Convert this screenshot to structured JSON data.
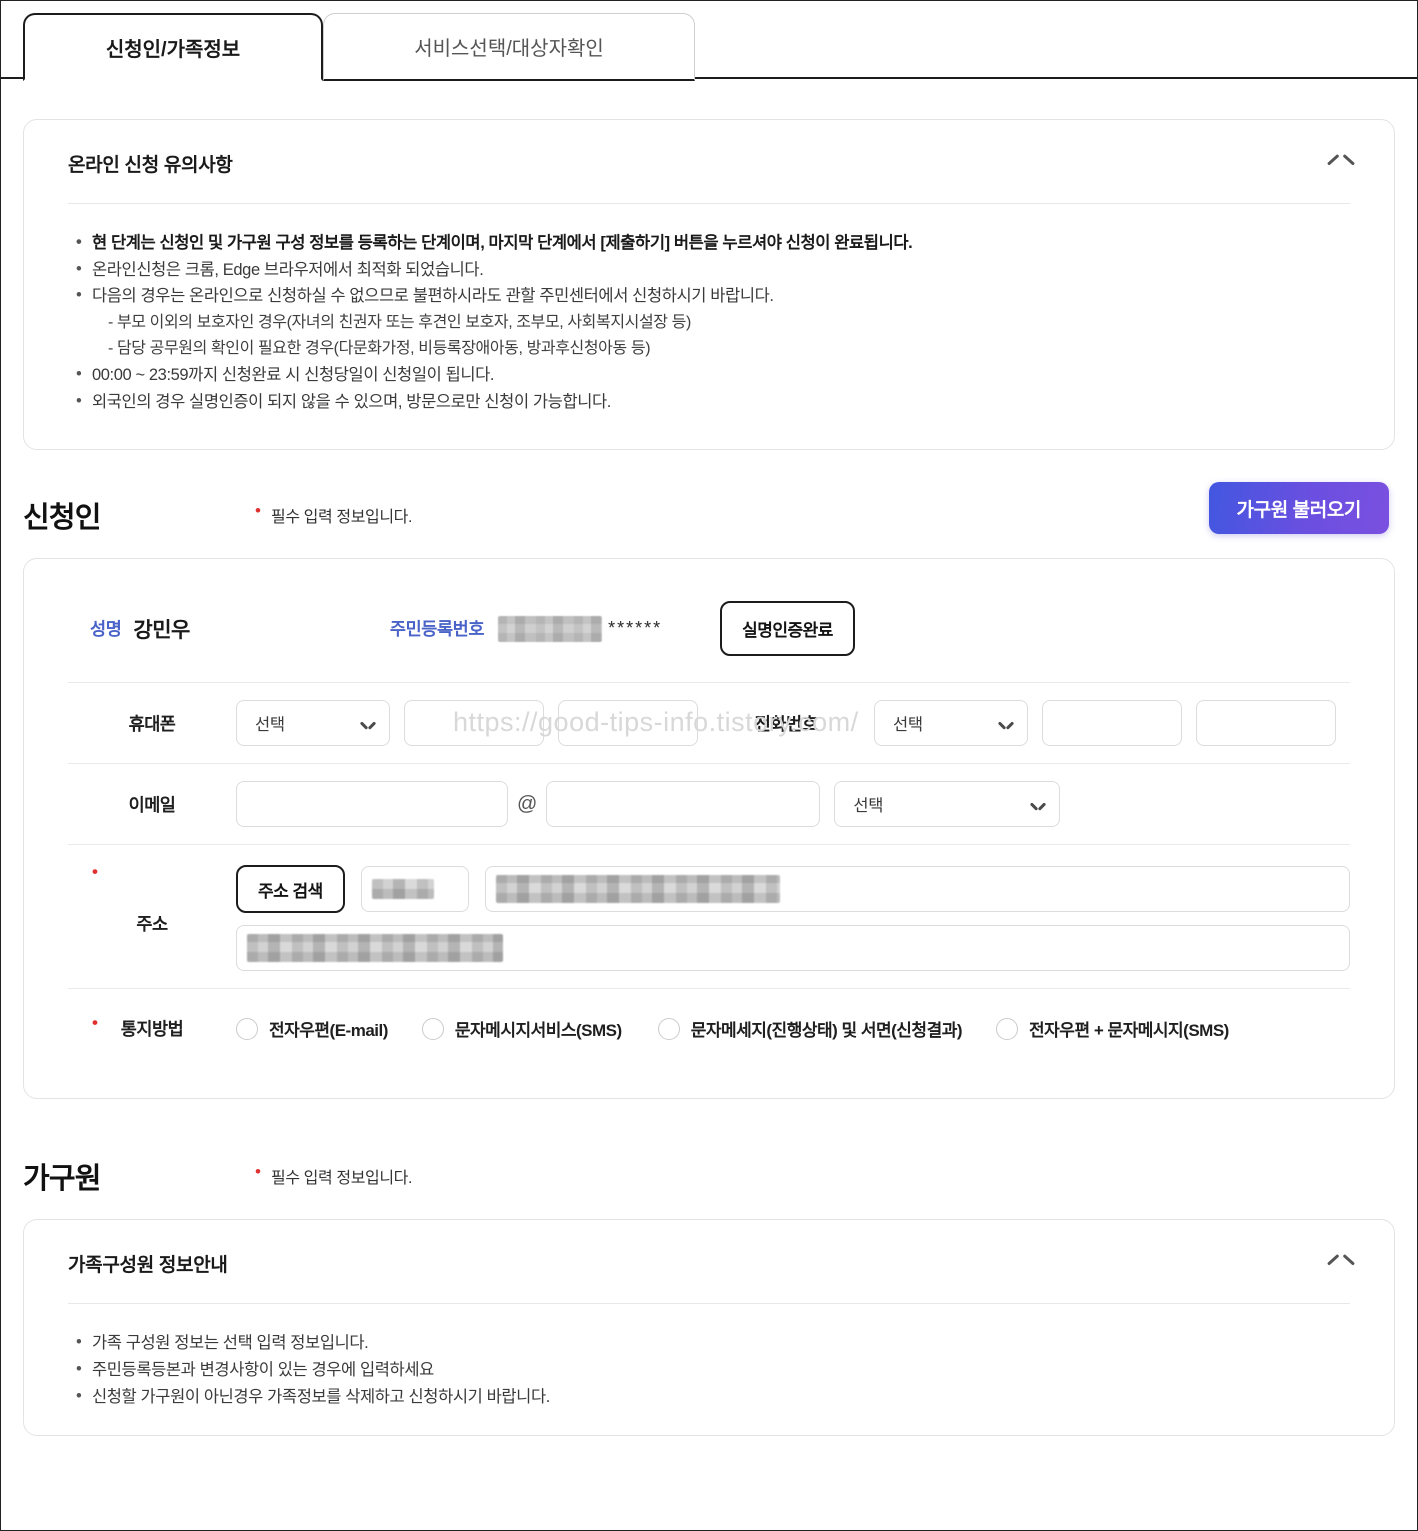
{
  "tabs": [
    {
      "label": "신청인/가족정보",
      "active": true
    },
    {
      "label": "서비스선택/대상자확인",
      "active": false
    }
  ],
  "notice_panel": {
    "title": "온라인 신청 유의사항",
    "collapse_icon": "chevron-up-icon",
    "items": [
      {
        "text": "현 단계는 신청인 및 가구원 구성 정보를 등록하는 단계이며, 마지막 단계에서 [제출하기] 버튼을 누르셔야 신청이 완료됩니다.",
        "style": "bold",
        "bullet": true
      },
      {
        "text": "온라인신청은 크롬, Edge 브라우저에서 최적화 되었습니다.",
        "style": "normal",
        "bullet": true
      },
      {
        "text": "다음의 경우는 온라인으로 신청하실 수 없으므로 불편하시라도 관할 주민센터에서 신청하시기 바랍니다.",
        "style": "normal",
        "bullet": true
      },
      {
        "text": "- 부모 이외의 보호자인 경우(자녀의 친권자 또는 후견인 보호자, 조부모, 사회복지시설장 등)",
        "style": "sub",
        "bullet": false
      },
      {
        "text": "- 담당 공무원의 확인이 필요한 경우(다문화가정, 비등록장애아동, 방과후신청아동 등)",
        "style": "sub",
        "bullet": false
      },
      {
        "text": "00:00 ~ 23:59까지 신청완료 시 신청당일이 신청일이 됩니다.",
        "style": "normal",
        "bullet": true
      },
      {
        "text": "외국인의 경우 실명인증이 되지 않을 수 있으며, 방문으로만 신청이 가능합니다.",
        "style": "normal",
        "bullet": true
      }
    ]
  },
  "applicant_section": {
    "title": "신청인",
    "required_note": "필수 입력 정보입니다.",
    "household_button": "가구원 불러오기",
    "name_label": "성명",
    "name_value": "강민우",
    "rrn_label": "주민등록번호",
    "rrn_masked_suffix": "******",
    "verified_badge": "실명인증완료",
    "mobile": {
      "label": "휴대폰",
      "select_value": "선택",
      "part2": "",
      "part3": ""
    },
    "telephone": {
      "label": "전화번호",
      "select_value": "선택",
      "part2": "",
      "part3": ""
    },
    "email": {
      "label": "이메일",
      "local": "",
      "at": "@",
      "domain": "",
      "select_value": "선택"
    },
    "address": {
      "label": "주소",
      "search_button": "주소 검색",
      "zipcode": "",
      "line1": "",
      "line2": ""
    },
    "notify": {
      "label": "통지방법",
      "options": [
        {
          "label": "전자우편(E-mail)",
          "selected": false
        },
        {
          "label": "문자메시지서비스(SMS)",
          "selected": false
        },
        {
          "label": "문자메세지(진행상태) 및 서면(신청결과)",
          "selected": false
        },
        {
          "label": "전자우편 + 문자메시지(SMS)",
          "selected": false
        }
      ]
    }
  },
  "household_section": {
    "title": "가구원",
    "required_note": "필수 입력 정보입니다."
  },
  "family_panel": {
    "title": "가족구성원 정보안내",
    "collapse_icon": "chevron-up-icon",
    "items": [
      "가족 구성원 정보는 선택 입력 정보입니다.",
      "주민등록등본과 변경사항이 있는 경우에 입력하세요",
      "신청할 가구원이 아닌경우 가족정보를 삭제하고 신청하시기 바랍니다."
    ]
  },
  "watermark": "https://good-tips-info.tistory.com/",
  "colors": {
    "accent_purple": "#6a4fe0",
    "label_blue": "#4a63c8",
    "required_red": "#e03131",
    "border_gray": "#e3e3e6"
  }
}
